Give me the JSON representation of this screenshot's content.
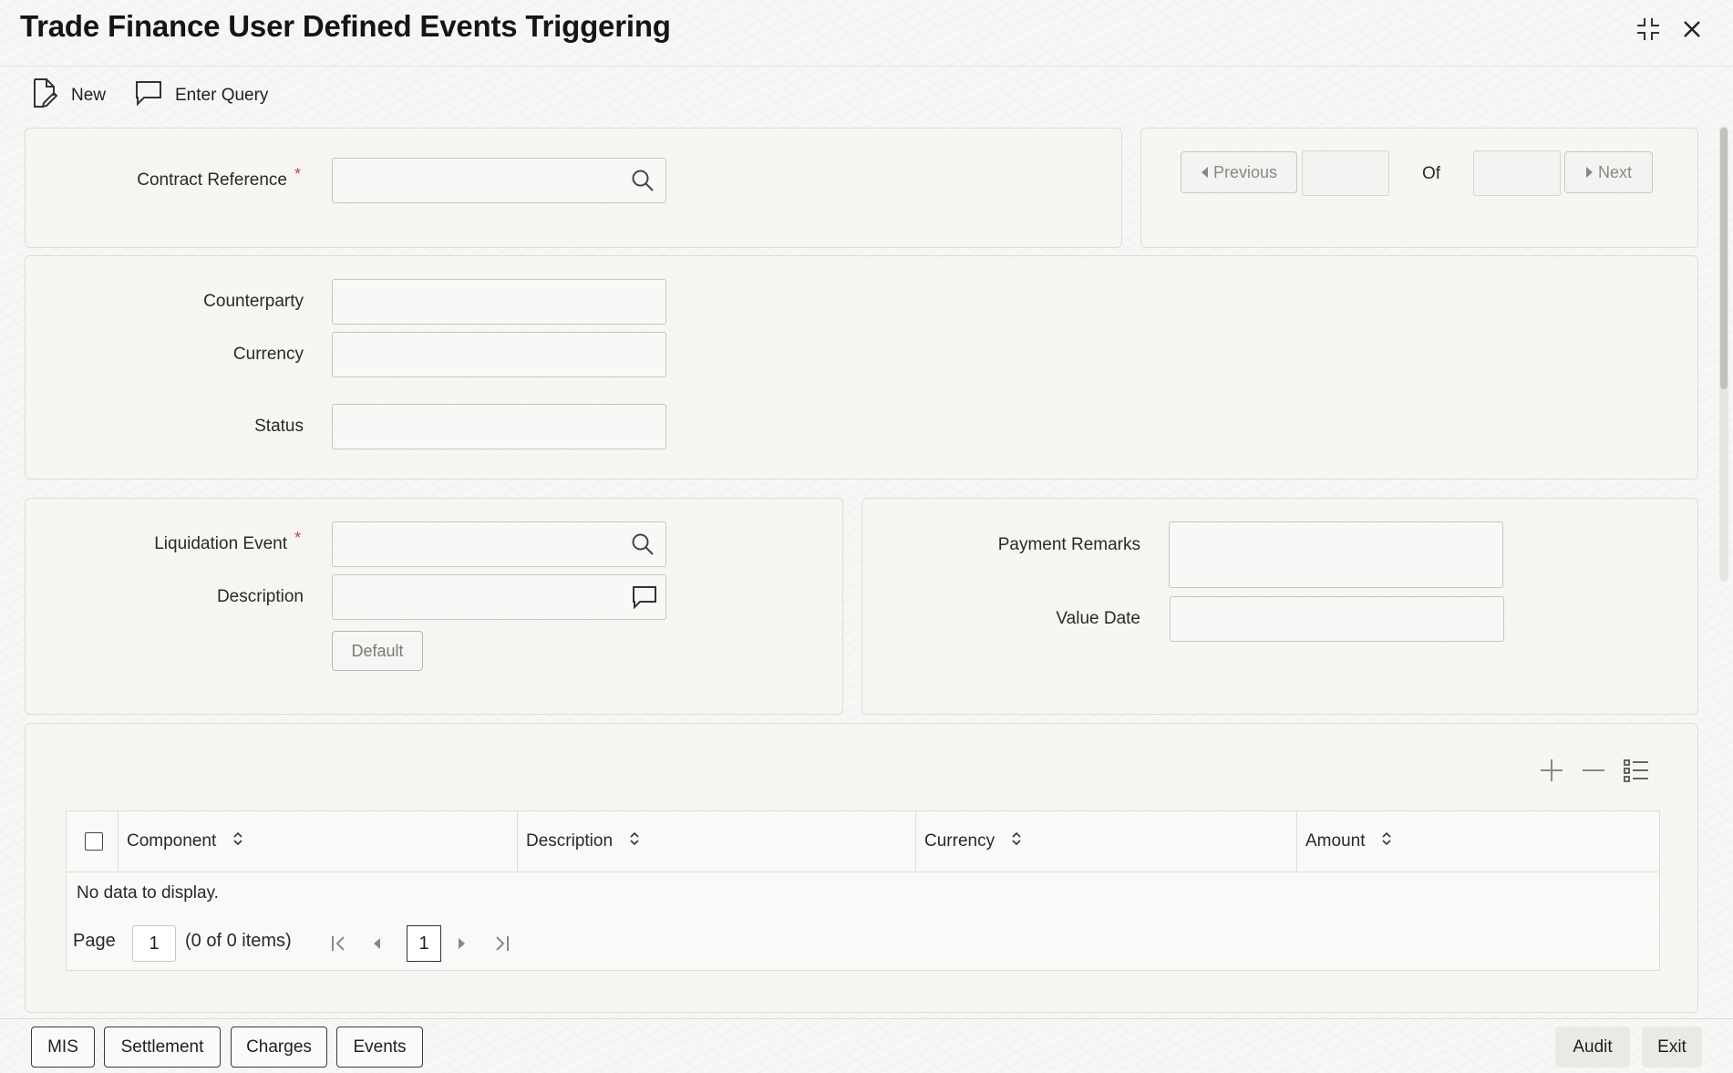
{
  "window": {
    "title": "Trade Finance User Defined Events Triggering"
  },
  "toolbar": {
    "new_label": "New",
    "enter_query_label": "Enter Query"
  },
  "header": {
    "contract_reference_label": "Contract Reference",
    "contract_reference_value": "",
    "required_mark": "*",
    "previous_label": "Previous",
    "of_label": "Of",
    "next_label": "Next"
  },
  "details": {
    "counterparty_label": "Counterparty",
    "currency_label": "Currency",
    "status_label": "Status"
  },
  "event": {
    "liquidation_event_label": "Liquidation Event",
    "description_label": "Description",
    "default_button": "Default",
    "payment_remarks_label": "Payment Remarks",
    "value_date_label": "Value Date"
  },
  "grid": {
    "columns": [
      "Component",
      "Description",
      "Currency",
      "Amount"
    ],
    "empty_message": "No data to display.",
    "page_label": "Page",
    "page_value": "1",
    "items_summary": "(0 of 0 items)",
    "current_page": "1"
  },
  "footer": {
    "mis_label": "MIS",
    "settlement_label": "Settlement",
    "charges_label": "Charges",
    "events_label": "Events",
    "audit_label": "Audit",
    "exit_label": "Exit"
  },
  "colors": {
    "required": "#c74634",
    "background": "#f8f7f5",
    "border": "#c9c7c3"
  }
}
